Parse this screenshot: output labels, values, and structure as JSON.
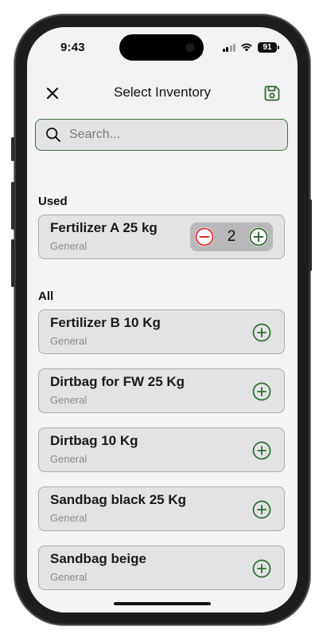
{
  "status": {
    "time": "9:43",
    "battery": "91"
  },
  "nav": {
    "title": "Select Inventory"
  },
  "search": {
    "placeholder": "Search..."
  },
  "sections": {
    "used": "Used",
    "all": "All"
  },
  "used_items": [
    {
      "name": "Fertilizer A 25 kg",
      "category": "General",
      "quantity": "2"
    }
  ],
  "all_items": [
    {
      "name": "Fertilizer B 10 Kg",
      "category": "General"
    },
    {
      "name": "Dirtbag for FW 25 Kg",
      "category": "General"
    },
    {
      "name": "Dirtbag 10 Kg",
      "category": "General"
    },
    {
      "name": "Sandbag black 25 Kg",
      "category": "General"
    },
    {
      "name": "Sandbag beige",
      "category": "General"
    }
  ],
  "colors": {
    "accent_green": "#2f6b2f",
    "minus_red": "#d92b2b",
    "card_bg": "#e3e3e5",
    "screen_bg": "#f4f4f5"
  },
  "icons": {
    "close": "close-icon",
    "save": "floppy-disk-icon",
    "search": "search-icon",
    "add": "plus-circle-icon",
    "minus": "minus-circle-icon"
  }
}
